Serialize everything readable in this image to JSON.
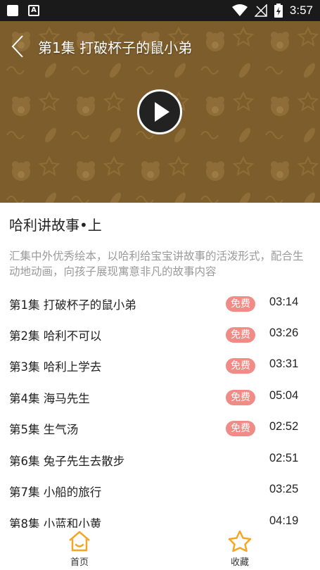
{
  "status_bar": {
    "time": "3:57"
  },
  "player": {
    "title": "第1集 打破杯子的鼠小弟",
    "accent": "#7d5d2c"
  },
  "series": {
    "title": "哈利讲故事•上",
    "description": "汇集中外优秀绘本，以哈利给宝宝讲故事的活泼形式，配合生动地动画，向孩子展现寓意非凡的故事内容"
  },
  "episodes": [
    {
      "title": "第1集 打破杯子的鼠小弟",
      "badge": "免费",
      "duration": "03:14"
    },
    {
      "title": "第2集 哈利不可以",
      "badge": "免费",
      "duration": "03:26"
    },
    {
      "title": "第3集 哈利上学去",
      "badge": "免费",
      "duration": "03:31"
    },
    {
      "title": "第4集 海马先生",
      "badge": "免费",
      "duration": "05:04"
    },
    {
      "title": "第5集 生气汤",
      "badge": "免费",
      "duration": "02:52"
    },
    {
      "title": "第6集 兔子先生去散步",
      "badge": "",
      "duration": "02:51"
    },
    {
      "title": "第7集 小船的旅行",
      "badge": "",
      "duration": "03:25"
    },
    {
      "title": "第8集 小蓝和小黄",
      "badge": "",
      "duration": "04:19"
    }
  ],
  "tabbar": {
    "home_label": "首页",
    "favorites_label": "收藏",
    "accent": "#f5a623"
  },
  "colors": {
    "badge": "#f08b85",
    "description": "#9a9a9a"
  }
}
